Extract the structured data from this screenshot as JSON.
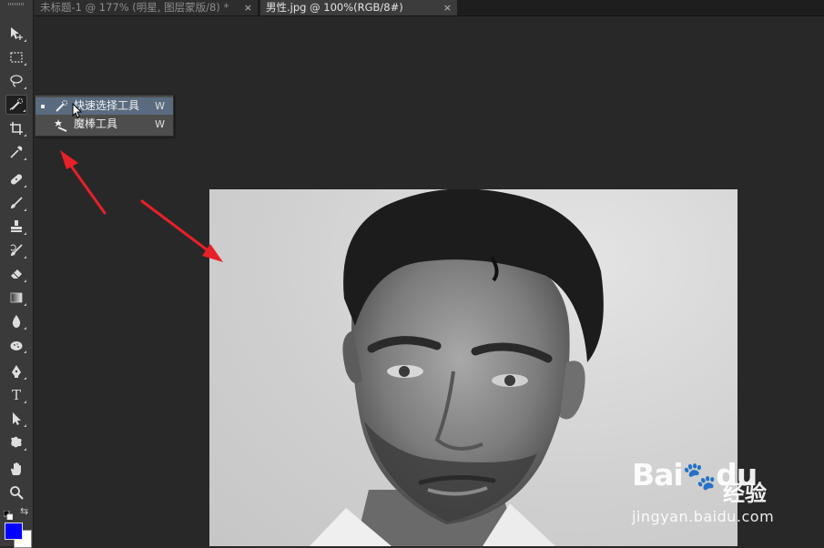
{
  "tabs": [
    {
      "label": "未标题-1 @ 177% (明星, 图层蒙版/8) *",
      "close": "×",
      "active": false
    },
    {
      "label": "男性.jpg @ 100%(RGB/8#)",
      "close": "×",
      "active": true
    }
  ],
  "toolbar": {
    "tools": [
      {
        "name": "move-tool",
        "icon": "move-icon"
      },
      {
        "name": "marquee-tool",
        "icon": "rect-marquee-icon"
      },
      {
        "name": "lasso-tool",
        "icon": "lasso-icon"
      },
      {
        "name": "quick-selection-tool",
        "icon": "quick-selection-icon",
        "selected": true
      },
      {
        "name": "crop-tool",
        "icon": "crop-icon"
      },
      {
        "name": "eyedropper-tool",
        "icon": "eyedropper-icon"
      },
      {
        "name": "healing-brush-tool",
        "icon": "bandage-icon"
      },
      {
        "name": "brush-tool",
        "icon": "brush-icon"
      },
      {
        "name": "clone-stamp-tool",
        "icon": "stamp-icon"
      },
      {
        "name": "history-brush-tool",
        "icon": "history-brush-icon"
      },
      {
        "name": "eraser-tool",
        "icon": "eraser-icon"
      },
      {
        "name": "gradient-tool",
        "icon": "gradient-icon"
      },
      {
        "name": "blur-tool",
        "icon": "drop-icon"
      },
      {
        "name": "dodge-tool",
        "icon": "sponge-icon"
      },
      {
        "name": "pen-tool",
        "icon": "pen-icon"
      },
      {
        "name": "type-tool",
        "icon": "type-icon",
        "text": "T"
      },
      {
        "name": "path-selection-tool",
        "icon": "arrow-cursor-icon"
      },
      {
        "name": "shape-tool",
        "icon": "custom-shape-icon"
      },
      {
        "name": "hand-tool",
        "icon": "hand-icon"
      },
      {
        "name": "zoom-tool",
        "icon": "magnifier-icon"
      }
    ],
    "foreground_color": "#0000ff",
    "background_color": "#ffffff"
  },
  "flyout": {
    "items": [
      {
        "label": "快速选择工具",
        "shortcut": "W",
        "icon": "quick-selection-icon",
        "active": true
      },
      {
        "label": "魔棒工具",
        "shortcut": "W",
        "icon": "magic-wand-icon",
        "active": false
      }
    ]
  },
  "watermark": {
    "brand_left": "Bai",
    "brand_right": "du",
    "brand_cn": "经验",
    "url": "jingyan.baidu.com"
  },
  "colors": {
    "canvas_bg": "#282828",
    "toolbar_bg": "#3a3a3a",
    "flyout_highlight": "#5a6b80",
    "annotation_arrow": "#e8202a"
  }
}
